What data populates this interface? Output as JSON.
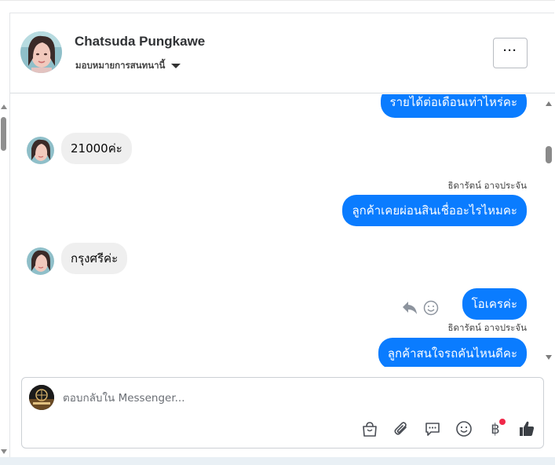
{
  "header": {
    "name": "Chatsuda Pungkawe",
    "assign_label": "มอบหมายการสนทนานี้",
    "more_label": "···"
  },
  "messages": [
    {
      "direction": "out",
      "text": "รายได้ต่อเดือนเท่าไหร่คะ"
    },
    {
      "direction": "in",
      "text": "21000ค่ะ"
    },
    {
      "direction": "out",
      "sender": "ธิดารัตน์ อาจประจัน",
      "text": "ลูกค้าเคยผ่อนสินเชื่ออะไรไหมคะ"
    },
    {
      "direction": "in",
      "text": "กรุงศรีค่ะ"
    },
    {
      "direction": "out",
      "text": "โอเครค่ะ"
    },
    {
      "direction": "out",
      "sender": "ธิดารัตน์ อาจประจัน",
      "text": "ลูกค้าสนใจรถคันไหนดีคะ"
    }
  ],
  "composer": {
    "placeholder": "ตอบกลับใน Messenger...",
    "tools": [
      "bag-icon",
      "paperclip-icon",
      "saved-reply-icon",
      "emoji-icon",
      "baht-icon",
      "thumbs-up-icon"
    ],
    "baht_symbol": "฿"
  },
  "colors": {
    "outgoing_bubble": "#0a7cff",
    "incoming_bubble": "#efefef",
    "notification_dot": "#f02849"
  }
}
